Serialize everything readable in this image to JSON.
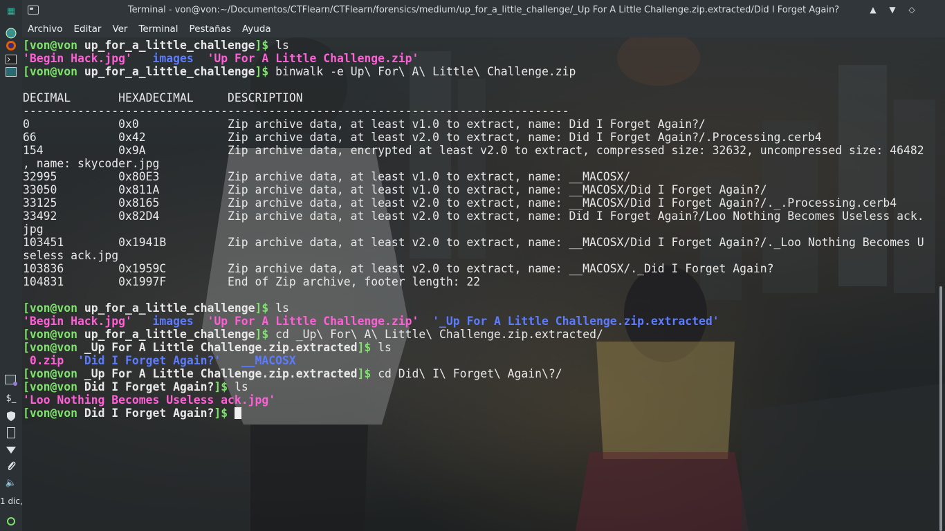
{
  "window": {
    "title": "Terminal - von@von:~/Documentos/CTFlearn/CTFlearn/forensics/medium/up_for_a_little_challenge/_Up For A Little Challenge.zip.extracted/Did I Forget Again?"
  },
  "panel": {
    "icons": [
      "app-menu-icon",
      "globe-icon",
      "firefox-icon",
      "terminal-icon",
      "files-icon",
      "terminal-icon",
      "shield-icon",
      "keyboard-icon",
      "wifi-icon",
      "clip-icon",
      "volume-icon"
    ],
    "clock": "1 dic,"
  },
  "menu": [
    "Archivo",
    "Editar",
    "Ver",
    "Terminal",
    "Pestañas",
    "Ayuda"
  ],
  "terminal": {
    "prompt_user": "[von@von",
    "prompt_end": "]$",
    "dir1": "up_for_a_little_challenge",
    "dir2": "_Up For A Little Challenge.zip.extracted",
    "dir3": "Did I Forget Again?",
    "cmd_ls": "ls",
    "ls1": [
      "'Begin Hack.jpg'",
      "images",
      "'Up For A Little Challenge.zip'"
    ],
    "cmd_binwalk": "binwalk -e Up\\ For\\ A\\ Little\\ Challenge.zip",
    "binwalk_header": "DECIMAL       HEXADECIMAL     DESCRIPTION",
    "binwalk_rule": "--------------------------------------------------------------------------------",
    "binwalk_rows": [
      "0             0x0             Zip archive data, at least v1.0 to extract, name: Did I Forget Again?/",
      "66            0x42            Zip archive data, at least v2.0 to extract, name: Did I Forget Again?/.Processing.cerb4",
      "154           0x9A            Zip archive data, encrypted at least v2.0 to extract, compressed size: 32632, uncompressed size: 46482",
      ", name: skycoder.jpg",
      "32995         0x80E3          Zip archive data, at least v1.0 to extract, name: __MACOSX/",
      "33050         0x811A          Zip archive data, at least v1.0 to extract, name: __MACOSX/Did I Forget Again?/",
      "33125         0x8165          Zip archive data, at least v2.0 to extract, name: __MACOSX/Did I Forget Again?/._.Processing.cerb4",
      "33492         0x82D4          Zip archive data, at least v2.0 to extract, name: Did I Forget Again?/Loo Nothing Becomes Useless ack.",
      "jpg",
      "103451        0x1941B         Zip archive data, at least v2.0 to extract, name: __MACOSX/Did I Forget Again?/._Loo Nothing Becomes U",
      "seless ack.jpg",
      "103836        0x1959C         Zip archive data, at least v2.0 to extract, name: __MACOSX/._Did I Forget Again?",
      "104831        0x1997F         End of Zip archive, footer length: 22"
    ],
    "ls2": [
      "'Begin Hack.jpg'",
      "images",
      "'Up For A Little Challenge.zip'",
      "'_Up For A Little Challenge.zip.extracted'"
    ],
    "cmd_cd1": "cd _Up\\ For\\ A\\ Little\\ Challenge.zip.extracted/",
    "ls3": [
      "0.zip",
      "'Did I Forget Again?'",
      "__MACOSX"
    ],
    "cmd_cd2": "cd Did\\ I\\ Forget\\ Again\\?/",
    "ls4": [
      "'Loo Nothing Becomes Useless ack.jpg'"
    ]
  }
}
